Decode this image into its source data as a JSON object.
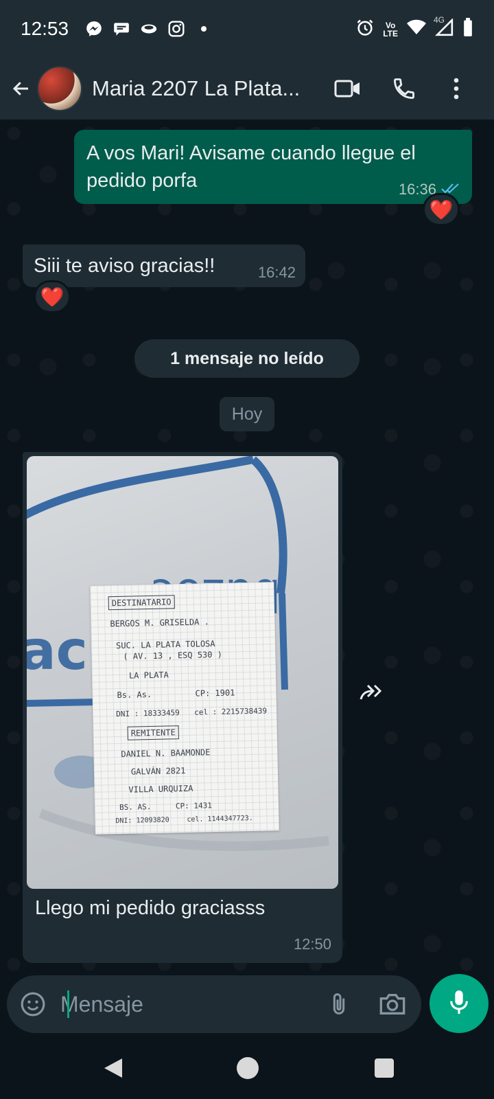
{
  "status_bar": {
    "time": "12:53",
    "left_icons": [
      "messenger-icon",
      "chat-bubble-icon",
      "cloud-icon",
      "instagram-icon",
      "dot-icon"
    ],
    "right_icons": [
      "alarm-icon",
      "volte-icon",
      "wifi-icon",
      "4g-signal-icon",
      "battery-icon"
    ],
    "volte_label": "Vo\nLTE",
    "network_label": "4G"
  },
  "header": {
    "title": "Maria 2207 La Plata...",
    "icons": [
      "back-arrow-icon",
      "video-call-icon",
      "phone-icon",
      "more-options-icon"
    ]
  },
  "messages": {
    "outgoing_1": {
      "text": "A vos Mari! Avisame cuando llegue el pedido porfa",
      "time": "16:36",
      "status": "read",
      "reaction": "❤️"
    },
    "incoming_1": {
      "text": "Siii te aviso gracias!!",
      "time": "16:42",
      "reaction": "❤️"
    },
    "unread_banner": "1 mensaje no leído",
    "date_separator": "Hoy",
    "incoming_image": {
      "caption": "Llego mi pedido graciasss",
      "time": "12:50",
      "label": {
        "destinatario_title": "DESTINATARIO",
        "name": "BERGOS M. GRISELDA .",
        "line1": "SUC. LA PLATA TOLOSA",
        "line2": "( AV. 13 , ESQ 530 )",
        "city": "LA PLATA",
        "province": "Bs. As.",
        "cp": "CP: 1901",
        "dni": "DNI : 18333459",
        "cel": "cel : 2215738439",
        "remitente_title": "REMITENTE",
        "sender_name": "DANIEL N. BAAMONDE",
        "sender_street": "GALVÁN 2821",
        "sender_city": "VILLA URQUIZA",
        "sender_province": "BS. AS.",
        "sender_cp": "CP: 1431",
        "sender_dni": "DNI: 12093820",
        "sender_cel": "cel. 1144347723."
      }
    }
  },
  "composer": {
    "placeholder": "Mensaje",
    "icons": [
      "emoji-icon",
      "attach-icon",
      "camera-icon",
      "microphone-icon"
    ]
  },
  "navigation": {
    "icons": [
      "nav-back-icon",
      "nav-home-icon",
      "nav-recents-icon"
    ]
  },
  "colors": {
    "background": "#0b141a",
    "bar": "#1f2c34",
    "outgoing_bubble": "#005c4b",
    "incoming_bubble": "#1f2c34",
    "accent": "#00a884",
    "read_ticks": "#53bdeb"
  }
}
